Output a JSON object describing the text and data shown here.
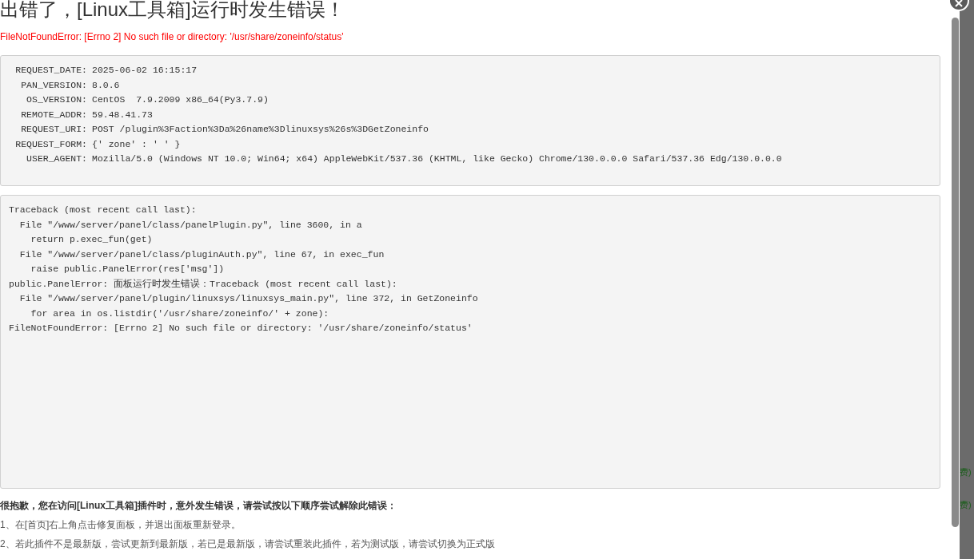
{
  "title": "出错了，[Linux工具箱]运行时发生错误！",
  "error_message": "FileNotFoundError: [Errno 2] No such file or directory: '/usr/share/zoneinfo/status'",
  "request_info": [
    {
      "key": "REQUEST_DATE:",
      "value": "2025-06-02 16:15:17"
    },
    {
      "key": "PAN_VERSION:",
      "value": "8.0.6"
    },
    {
      "key": "OS_VERSION:",
      "value": "CentOS  7.9.2009 x86_64(Py3.7.9)"
    },
    {
      "key": "REMOTE_ADDR:",
      "value": "59.48.41.73"
    },
    {
      "key": "REQUEST_URI:",
      "value": "POST /plugin%3Faction%3Da%26name%3Dlinuxsys%26s%3DGetZoneinfo"
    },
    {
      "key": "REQUEST_FORM:",
      "value": "{' zone' : ' ' }"
    },
    {
      "key": "USER_AGENT:",
      "value": "Mozilla/5.0 (Windows NT 10.0; Win64; x64) AppleWebKit/537.36 (KHTML, like Gecko) Chrome/130.0.0.0 Safari/537.36 Edg/130.0.0.0"
    }
  ],
  "traceback": [
    "Traceback (most recent call last):",
    "  File \"/www/server/panel/class/panelPlugin.py\", line 3600, in a",
    "    return p.exec_fun(get)",
    "  File \"/www/server/panel/class/pluginAuth.py\", line 67, in exec_fun",
    "    raise public.PanelError(res['msg'])",
    "public.PanelError: 面板运行时发生错误：Traceback (most recent call last):",
    "  File \"/www/server/panel/plugin/linuxsys/linuxsys_main.py\", line 372, in GetZoneinfo",
    "    for area in os.listdir('/usr/share/zoneinfo/' + zone):",
    "FileNotFoundError: [Errno 2] No such file or directory: '/usr/share/zoneinfo/status'"
  ],
  "help_heading": "很抱歉，您在访问[Linux工具箱]插件时，意外发生错误，请尝试按以下顺序尝试解除此错误：",
  "help_steps": [
    "1、在[首页]右上角点击修复面板，并退出面板重新登录。",
    "2、若此插件不是最新版，尝试更新到最新版，若已是最新版，请尝试重装此插件，若为测试版，请尝试切换为正式版"
  ],
  "background_fragments": [
    "费)",
    "费)"
  ]
}
